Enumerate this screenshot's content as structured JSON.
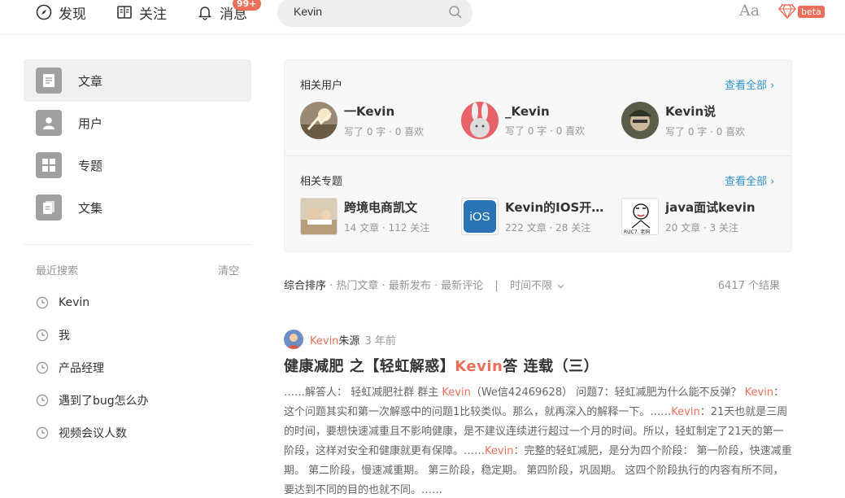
{
  "header": {
    "nav": {
      "discover": "发现",
      "follow": "关注",
      "messages": "消息",
      "badge": "99+"
    },
    "search": {
      "value": "Kevin"
    },
    "font_label": "Aa",
    "beta_label": "beta"
  },
  "sidebar": {
    "items": [
      {
        "label": "文章"
      },
      {
        "label": "用户"
      },
      {
        "label": "专题"
      },
      {
        "label": "文集"
      }
    ],
    "recent": {
      "title": "最近搜索",
      "clear": "清空",
      "items": [
        "Kevin",
        "我",
        "产品经理",
        "遇到了bug怎么办",
        "视频会议人数"
      ]
    }
  },
  "related_users": {
    "title": "相关用户",
    "more": "查看全部 ›",
    "items": [
      {
        "name": "一Kevin",
        "meta": "写了 0 字 · 0 喜欢"
      },
      {
        "name": "_Kevin",
        "meta": "写了 0 字 · 0 喜欢"
      },
      {
        "name": "Kevin说",
        "meta": "写了 0 字 · 0 喜欢"
      }
    ]
  },
  "related_topics": {
    "title": "相关专题",
    "more": "查看全部 ›",
    "items": [
      {
        "name": "跨境电商凯文",
        "meta": "14 文章 · 112 关注"
      },
      {
        "name": "Kevin的IOS开发...",
        "meta": "222 文章 · 28 关注",
        "icon_text": "iOS"
      },
      {
        "name": "java面试kevin",
        "meta": "20 文章 · 3 关注",
        "icon_text": "RUC7. 老码"
      }
    ]
  },
  "sort": {
    "options": [
      "综合排序",
      "热门文章",
      "最新发布",
      "最新评论"
    ],
    "separator": "|",
    "time_filter": "时间不限",
    "results": "6417 个结果"
  },
  "article": {
    "author_highlight": "Kevin",
    "author_rest": "朱源",
    "time": "3 年前",
    "title_pre": "健康减肥 之【轻虹解惑】",
    "title_hl": "Kevin",
    "title_post": "答 连载（三）",
    "abstract": [
      {
        "t": "……解答人： 轻虹减肥社群 群主 "
      },
      {
        "t": "Kevin",
        "hl": true
      },
      {
        "t": "（We信42469628） 问题7：轻虹减肥为什么能不反弹？ "
      },
      {
        "t": "Kevin",
        "hl": true
      },
      {
        "t": "：这个问题其实和第一次解惑中的问题1比较类似。那么，就再深入的解释一下。……"
      },
      {
        "t": "Kevin",
        "hl": true
      },
      {
        "t": "：21天也就是三周的时间，要想快速减重且不影响健康，是不建议连续进行超过一个月的时间。所以，轻虹制定了21天的第一阶段，这样对安全和健康就更有保障。……"
      },
      {
        "t": "Kevin",
        "hl": true
      },
      {
        "t": "：完整的轻虹减肥，是分为四个阶段： 第一阶段，快速减重期。 第二阶段，慢速减重期。 第三阶段，稳定期。 第四阶段，巩固期。 这四个阶段执行的内容有所不同，要达到不同的目的也就不同。……"
      }
    ]
  },
  "colors": {
    "accent": "#ea6f5a",
    "link": "#3194d0",
    "muted": "#969696"
  }
}
